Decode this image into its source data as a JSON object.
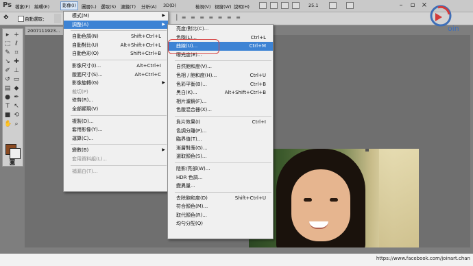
{
  "app": {
    "short_name": "Ps"
  },
  "menubar": {
    "items": [
      "檔案(F)",
      "編輯(E)",
      "影像(I)",
      "圖層(L)",
      "選取(S)",
      "濾鏡(T)",
      "分析(A)",
      "3D(D)",
      "檢視(V)",
      "視窗(W)",
      "說明(H)"
    ],
    "active_index": 2,
    "zoom": "25.1"
  },
  "options_bar": {
    "auto_select_label": "自動選取："
  },
  "document": {
    "tab_title": "2007111923..."
  },
  "image_menu": {
    "items": [
      {
        "label": "模式(M)",
        "shortcut": "",
        "submenu": true
      },
      {
        "label": "調整(A)",
        "shortcut": "",
        "submenu": true,
        "highlighted": true
      },
      {
        "sep": true
      },
      {
        "label": "自動色調(N)",
        "shortcut": "Shift+Ctrl+L"
      },
      {
        "label": "自動對比(U)",
        "shortcut": "Alt+Shift+Ctrl+L"
      },
      {
        "label": "自動色彩(O)",
        "shortcut": "Shift+Ctrl+B"
      },
      {
        "sep": true
      },
      {
        "label": "影像尺寸(I)...",
        "shortcut": "Alt+Ctrl+I"
      },
      {
        "label": "版面尺寸(S)...",
        "shortcut": "Alt+Ctrl+C"
      },
      {
        "label": "影像旋轉(G)",
        "shortcut": "",
        "submenu": true
      },
      {
        "label": "裁切(P)",
        "shortcut": "",
        "disabled": true
      },
      {
        "label": "修剪(R)...",
        "shortcut": ""
      },
      {
        "label": "全部顯現(V)",
        "shortcut": ""
      },
      {
        "sep": true
      },
      {
        "label": "複製(D)...",
        "shortcut": ""
      },
      {
        "label": "套用影像(Y)...",
        "shortcut": ""
      },
      {
        "label": "運算(C)...",
        "shortcut": ""
      },
      {
        "sep": true
      },
      {
        "label": "變數(B)",
        "shortcut": "",
        "submenu": true
      },
      {
        "label": "套用資料組(L)...",
        "shortcut": "",
        "disabled": true
      },
      {
        "sep": true
      },
      {
        "label": "補漏白(T)...",
        "shortcut": "",
        "disabled": true
      }
    ]
  },
  "adjust_menu": {
    "items": [
      {
        "label": "亮度/對比(C)...",
        "shortcut": ""
      },
      {
        "label": "色階(L)...",
        "shortcut": "Ctrl+L"
      },
      {
        "label": "曲線(U)...",
        "shortcut": "Ctrl+M",
        "highlighted": true
      },
      {
        "label": "曝光度(E)...",
        "shortcut": ""
      },
      {
        "sep": true
      },
      {
        "label": "自然飽和度(V)...",
        "shortcut": ""
      },
      {
        "label": "色相 / 飽和度(H)...",
        "shortcut": "Ctrl+U"
      },
      {
        "label": "色彩平衡(B)...",
        "shortcut": "Ctrl+B"
      },
      {
        "label": "黑白(K)...",
        "shortcut": "Alt+Shift+Ctrl+B"
      },
      {
        "label": "相片濾鏡(F)...",
        "shortcut": ""
      },
      {
        "label": "色版混合器(X)...",
        "shortcut": ""
      },
      {
        "sep": true
      },
      {
        "label": "負片效果(I)",
        "shortcut": "Ctrl+I"
      },
      {
        "label": "色調分離(P)...",
        "shortcut": ""
      },
      {
        "label": "臨界值(T)...",
        "shortcut": ""
      },
      {
        "label": "漸層對應(G)...",
        "shortcut": ""
      },
      {
        "label": "選取顏色(S)...",
        "shortcut": ""
      },
      {
        "sep": true
      },
      {
        "label": "陰影/亮部(W)...",
        "shortcut": ""
      },
      {
        "label": "HDR 色調...",
        "shortcut": ""
      },
      {
        "label": "變異量...",
        "shortcut": ""
      },
      {
        "sep": true
      },
      {
        "label": "去除飽和度(D)",
        "shortcut": "Shift+Ctrl+U"
      },
      {
        "label": "符合顏色(M)...",
        "shortcut": ""
      },
      {
        "label": "取代顏色(R)...",
        "shortcut": ""
      },
      {
        "label": "均勻分配(Q)",
        "shortcut": ""
      }
    ]
  },
  "logo": {
    "text": "oin"
  },
  "footer": {
    "url": "https://www.facebook.com/joinart.chan"
  },
  "colors": {
    "highlight": "#3d83d4",
    "foreground_swatch": "#8a4a22",
    "background_swatch": "#f0f0f0",
    "annotation_circle": "#d64040"
  }
}
